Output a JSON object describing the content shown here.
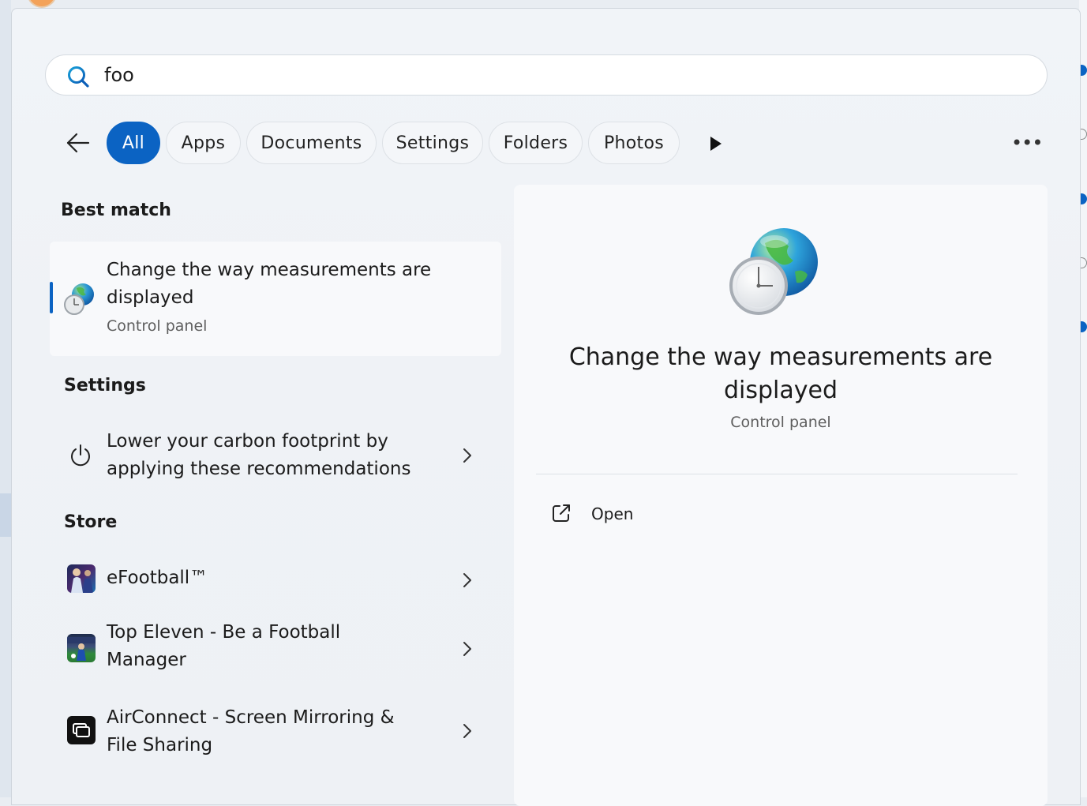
{
  "search": {
    "query": "foo"
  },
  "filters": [
    "All",
    "Apps",
    "Documents",
    "Settings",
    "Folders",
    "Photos"
  ],
  "sections": {
    "best_match": "Best match",
    "settings": "Settings",
    "store": "Store"
  },
  "best_match": {
    "title_line1": "Change the way measurements are",
    "title_line2": "displayed",
    "subtitle": "Control panel"
  },
  "settings_result": {
    "line1": "Lower your carbon footprint by",
    "line2": "applying these recommendations"
  },
  "store_results": [
    {
      "line1": "eFootball™",
      "line2": ""
    },
    {
      "line1": "Top Eleven - Be a Football",
      "line2": "Manager"
    },
    {
      "line1": "AirConnect - Screen Mirroring &",
      "line2": "File Sharing"
    }
  ],
  "detail": {
    "title_line1": "Change the way measurements are",
    "title_line2": "displayed",
    "subtitle": "Control panel",
    "open_label": "Open"
  },
  "colors": {
    "accent": "#0b63c3",
    "panel": "#eff2f6"
  },
  "icons": {
    "search": "search-icon",
    "back": "back-arrow-icon",
    "more": "more-icon",
    "region": "globe-clock-icon",
    "power": "power-icon",
    "open": "open-external-icon"
  }
}
